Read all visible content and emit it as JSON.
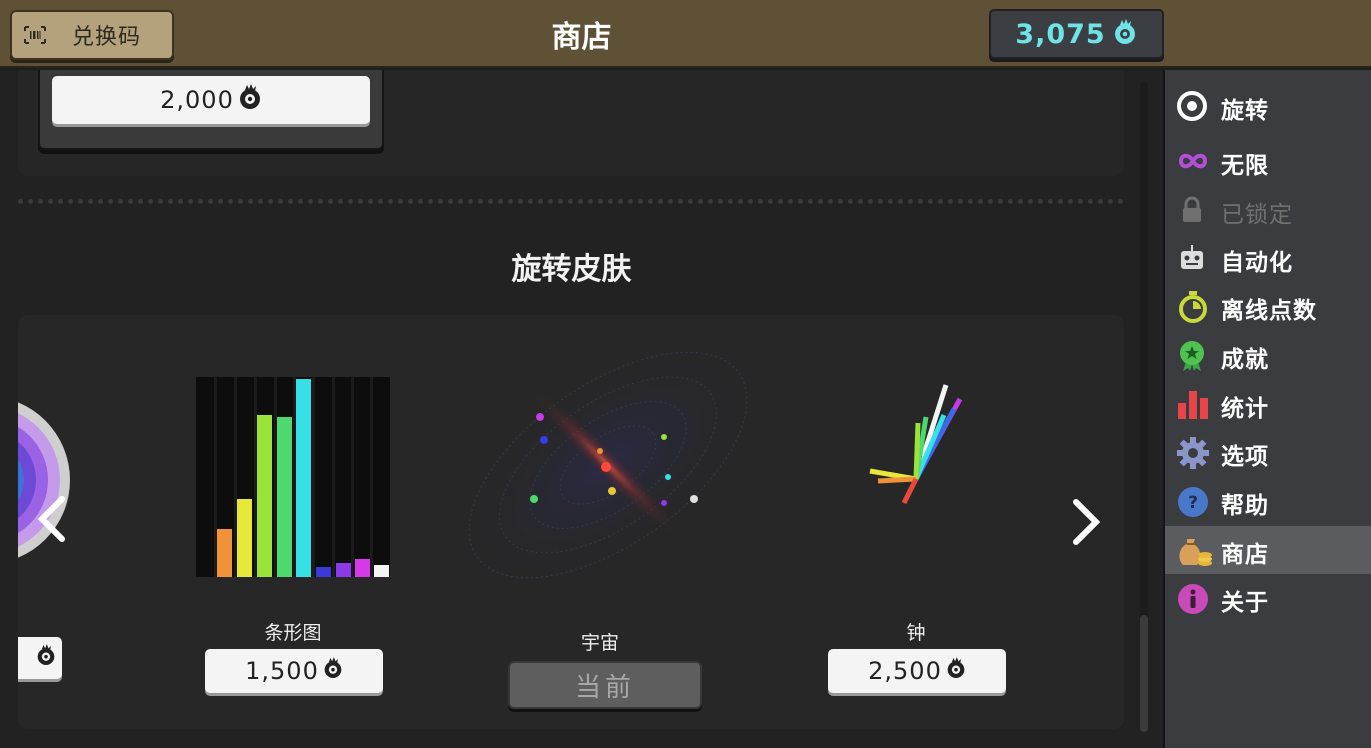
{
  "header": {
    "redeem_label": "兑换码",
    "title": "商店",
    "balance": "3,075"
  },
  "top_section": {
    "price": "2,000"
  },
  "skins_section": {
    "title": "旋转皮肤",
    "items": [
      {
        "name": "",
        "price": ""
      },
      {
        "name": "条形图",
        "price": "1,500"
      },
      {
        "name": "宇宙",
        "status": "当前"
      },
      {
        "name": "钟",
        "price": "2,500"
      }
    ]
  },
  "sidebar": {
    "items": [
      {
        "label": "旋转",
        "icon": "target-icon"
      },
      {
        "label": "无限",
        "icon": "infinity-icon"
      },
      {
        "label": "已锁定",
        "icon": "lock-icon"
      },
      {
        "label": "自动化",
        "icon": "robot-icon"
      },
      {
        "label": "离线点数",
        "icon": "stopwatch-icon"
      },
      {
        "label": "成就",
        "icon": "medal-icon"
      },
      {
        "label": "统计",
        "icon": "bar-chart-icon"
      },
      {
        "label": "选项",
        "icon": "gear-icon"
      },
      {
        "label": "帮助",
        "icon": "help-icon"
      },
      {
        "label": "商店",
        "icon": "money-bag-icon"
      },
      {
        "label": "关于",
        "icon": "info-icon"
      }
    ],
    "active_index": 9
  },
  "colors": {
    "header_bg": "#5e5136",
    "balance_text": "#6fe3e6",
    "sidebar_bg": "#3a3c3f",
    "active_item": "#5a5c5f"
  }
}
